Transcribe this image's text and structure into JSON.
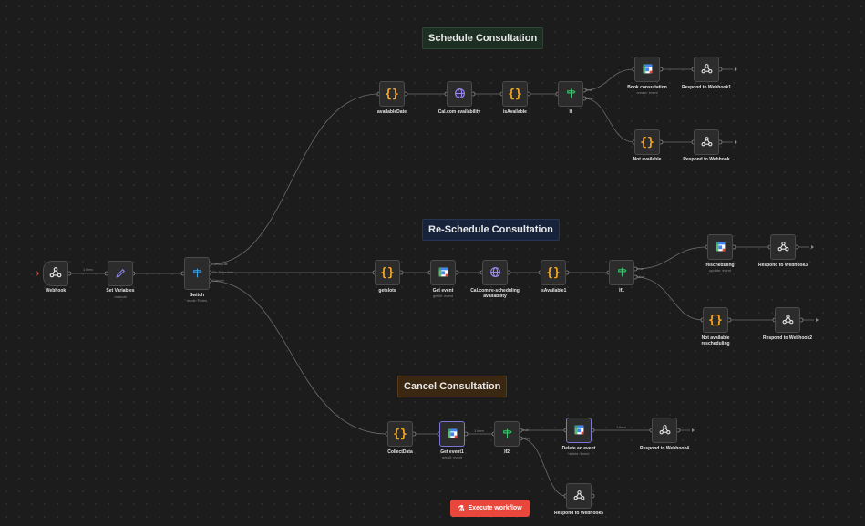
{
  "sticky_notes": [
    {
      "id": "schedule",
      "label": "Schedule Consultation",
      "color": "#1d2f22"
    },
    {
      "id": "reschedule",
      "label": "Re-Schedule Consultation",
      "color": "#17233a"
    },
    {
      "id": "cancel",
      "label": "Cancel Consultation",
      "color": "#3b2812"
    }
  ],
  "nodes": [
    {
      "id": "webhook",
      "label": "Webhook",
      "icon": "webhook-icon"
    },
    {
      "id": "set_variables",
      "label": "Set Variables",
      "sub": "manual",
      "icon": "pencil-icon"
    },
    {
      "id": "switch",
      "label": "Switch",
      "sub": "mode: Rules",
      "icon": "switch-signpost-icon"
    },
    {
      "id": "availableDate",
      "label": "availableDate",
      "icon": "code-braces-icon"
    },
    {
      "id": "cal_availability",
      "label": "Cal.com availability",
      "icon": "globe-icon"
    },
    {
      "id": "isAvailable",
      "label": "isAvailable",
      "icon": "code-braces-icon"
    },
    {
      "id": "if",
      "label": "If",
      "icon": "if-signpost-icon"
    },
    {
      "id": "book_consultation",
      "label": "Book consultation",
      "sub": "create: event",
      "icon": "google-calendar-icon"
    },
    {
      "id": "respond1",
      "label": "Respond to Webhook1",
      "icon": "webhook-icon"
    },
    {
      "id": "not_available",
      "label": "Not available",
      "icon": "code-braces-icon"
    },
    {
      "id": "respond",
      "label": "Respond to Webhook",
      "icon": "webhook-icon"
    },
    {
      "id": "getslots",
      "label": "getslots",
      "icon": "code-braces-icon"
    },
    {
      "id": "get_event",
      "label": "Get event",
      "sub": "getAll: event",
      "icon": "google-calendar-icon"
    },
    {
      "id": "cal_rescheduling",
      "label": "Cal.com re-scheduling availability",
      "icon": "globe-icon"
    },
    {
      "id": "isAvailable1",
      "label": "isAvailable1",
      "icon": "code-braces-icon"
    },
    {
      "id": "if1",
      "label": "If1",
      "icon": "if-signpost-icon"
    },
    {
      "id": "rescheduling",
      "label": "rescheduling",
      "sub": "update: event",
      "icon": "google-calendar-icon"
    },
    {
      "id": "respond3",
      "label": "Respond to Webhook3",
      "icon": "webhook-icon"
    },
    {
      "id": "not_available_rescheduling",
      "label": "Not available rescheduling",
      "icon": "code-braces-icon"
    },
    {
      "id": "respond2",
      "label": "Respond to Webhook2",
      "icon": "webhook-icon"
    },
    {
      "id": "collectdata",
      "label": "CollectData",
      "icon": "code-braces-icon"
    },
    {
      "id": "get_event1",
      "label": "Get event1",
      "sub": "getAll: event",
      "icon": "google-calendar-icon"
    },
    {
      "id": "if2",
      "label": "If2",
      "icon": "if-signpost-icon"
    },
    {
      "id": "delete_event",
      "label": "Delete an event",
      "sub": "delete: event",
      "icon": "google-calendar-icon"
    },
    {
      "id": "respond4",
      "label": "Respond to Webhook4",
      "icon": "webhook-icon"
    },
    {
      "id": "respond5",
      "label": "Respond to Webhook5",
      "icon": "webhook-icon"
    }
  ],
  "edge_labels": {
    "webhook_to_set": "1 item",
    "delete_to_respond4": "1 item",
    "get_event1_to_if2": "1 item"
  },
  "port_labels": {
    "true": "true",
    "false": "false",
    "switch_out0": "Schedule",
    "switch_out1": "Re-Schedule",
    "switch_out2": "Cancel"
  },
  "toolbar": {
    "execute_label": "Execute workflow",
    "execute_icon": "flask-icon"
  },
  "colors": {
    "canvas": "#1c1c1c",
    "node_bg": "#2c2c2c",
    "edge": "#6b6b6b",
    "code_icon": "#f5a623",
    "globe_icon": "#9d8cf5",
    "if_icon": "#37c76b",
    "switch_icon": "#3aa0e8",
    "execute_button": "#e9473b"
  }
}
